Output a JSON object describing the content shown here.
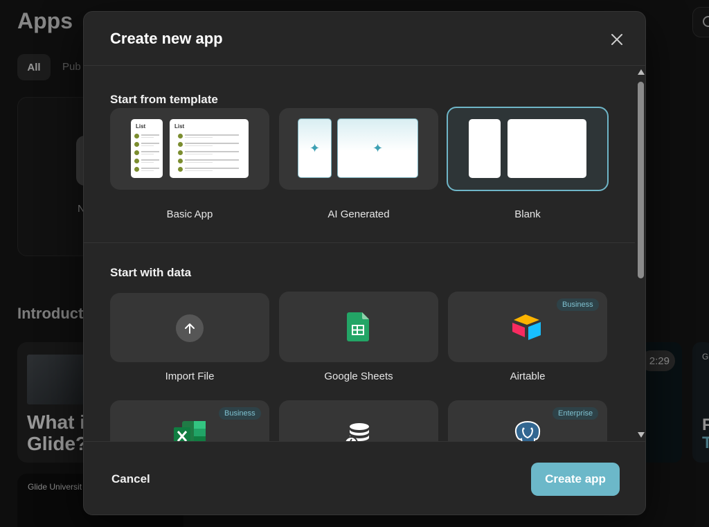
{
  "background": {
    "title": "Apps",
    "filter_all": "All",
    "filter_public": "Pub",
    "new_card_text": "N",
    "section_intro": "Introduct",
    "video_title": "What i\nGlide?",
    "video_time": "2:29",
    "third_card_letter_a": "G",
    "third_card_letter_b": "F",
    "third_card_letter_c": "T",
    "university_label": "Glide Universit"
  },
  "modal": {
    "title": "Create new app",
    "template_section": "Start from template",
    "templates": [
      {
        "label": "Basic App",
        "preview_list_label": "List"
      },
      {
        "label": "AI Generated"
      },
      {
        "label": "Blank",
        "selected": true
      }
    ],
    "data_section": "Start with data",
    "sources": [
      {
        "label": "Import File"
      },
      {
        "label": "Google Sheets"
      },
      {
        "label": "Airtable",
        "badge": "Business"
      },
      {
        "label": "",
        "badge": "Business"
      },
      {
        "label": ""
      },
      {
        "label": "",
        "badge": "Enterprise"
      }
    ],
    "cancel_label": "Cancel",
    "create_label": "Create app"
  },
  "colors": {
    "accent": "#6cb8c9",
    "selected_border": "#6fb6c8",
    "sheets_green": "#23a566",
    "excel_green": "#1f7a45",
    "badge_bg": "#2e4248",
    "badge_text": "#7fc1d0"
  }
}
